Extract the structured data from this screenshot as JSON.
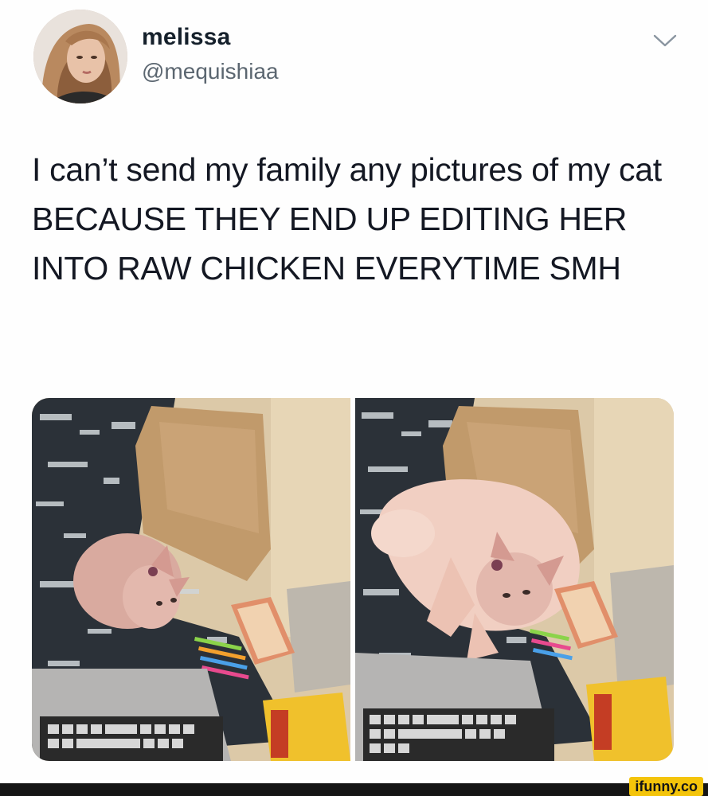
{
  "tweet": {
    "display_name": "melissa",
    "handle": "@mequishiaa",
    "text": "I can’t send my family any pictures of my cat BECAUSE THEY END UP EDITING HER INTO RAW CHICKEN EVERYTIME SMH",
    "menu_icon": "chevron-down-icon"
  },
  "media": [
    {
      "subject": "hairless cat on couch"
    },
    {
      "subject": "hairless cat edited into raw chicken on couch"
    }
  ],
  "watermark": {
    "text": "ifunny.co"
  },
  "colors": {
    "text": "#141823",
    "handle": "#5b6670",
    "watermark_bg": "#f4c40a",
    "footer_bar": "#151515"
  }
}
